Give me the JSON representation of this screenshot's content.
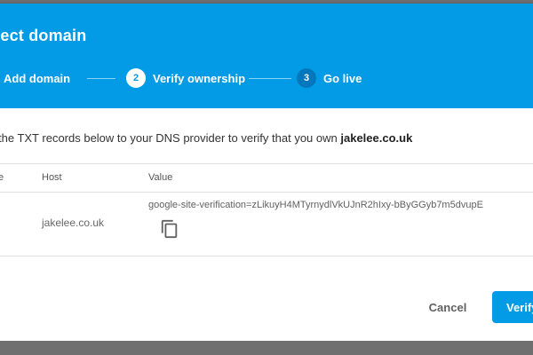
{
  "dialog": {
    "title": "nnect domain",
    "steps": [
      {
        "num": "",
        "label": "Add domain",
        "state": "done"
      },
      {
        "num": "2",
        "label": "Verify ownership",
        "state": "active"
      },
      {
        "num": "3",
        "label": "Go live",
        "state": "pending"
      }
    ],
    "instruction_prefix": "the TXT records below to your DNS provider to verify that you own",
    "domain": "jakelee.co.uk",
    "table": {
      "headers": [
        "e",
        "Host",
        "Value"
      ],
      "rows": [
        {
          "type": "",
          "host": "jakelee.co.uk",
          "value": "google-site-verification=zLikuyH4MTyrnydlVkUJnR2hIxy-bByGGyb7m5dvupE",
          "copy_icon": "copy-icon"
        }
      ]
    },
    "actions": {
      "cancel_label": "Cancel",
      "verify_label": "Verify"
    }
  },
  "colors": {
    "primary": "#039be5",
    "step_pending": "#0277bd",
    "overlay": "#6f6f6f"
  }
}
